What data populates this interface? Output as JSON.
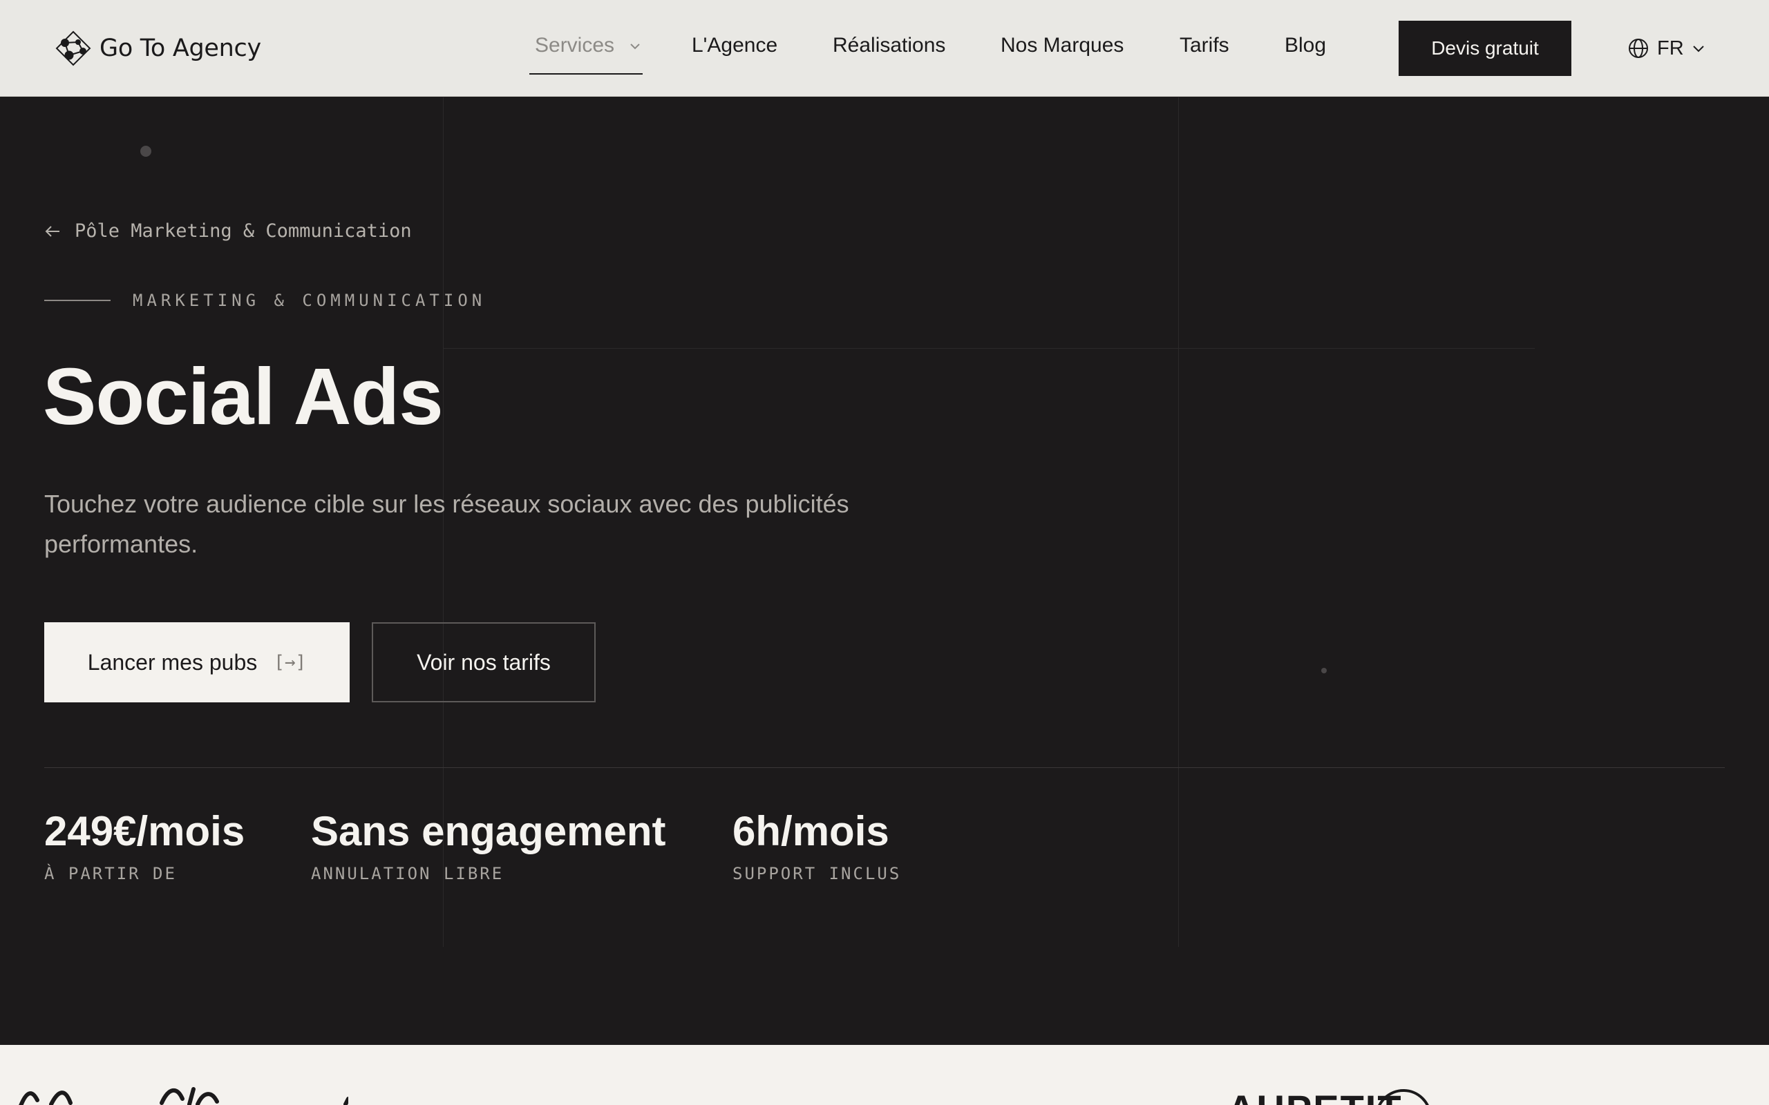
{
  "header": {
    "brand": "Go To Agency",
    "nav": [
      {
        "label": "Services",
        "active": true,
        "has_dropdown": true
      },
      {
        "label": "L'Agence"
      },
      {
        "label": "Réalisations"
      },
      {
        "label": "Nos Marques"
      },
      {
        "label": "Tarifs"
      },
      {
        "label": "Blog"
      }
    ],
    "cta": "Devis gratuit",
    "language": "FR",
    "icons": [
      "logo-mark-icon",
      "chevron-down-icon",
      "globe-icon"
    ]
  },
  "hero": {
    "back_link": "Pôle Marketing & Communication",
    "eyebrow": "MARKETING & COMMUNICATION",
    "title": "Social Ads",
    "subtitle": "Touchez votre audience cible sur les réseaux sociaux avec des publicités performantes.",
    "primary_button": "Lancer mes pubs",
    "primary_button_arrow": "[→]",
    "secondary_button": "Voir nos tarifs",
    "stats": [
      {
        "value": "249€/mois",
        "label": "À PARTIR DE"
      },
      {
        "value": "Sans engagement",
        "label": "ANNULATION LIBRE"
      },
      {
        "value": "6h/mois",
        "label": "SUPPORT INCLUS"
      }
    ]
  },
  "brands_strip": {
    "visible_fragments": [
      "AUPETIT"
    ]
  },
  "colors": {
    "nav_background": "#e9e8e4",
    "hero_background": "#1c1a1b",
    "text_light": "#f5f3ef",
    "text_muted": "#b3afaa",
    "accent_dark": "#1c1a1b"
  }
}
